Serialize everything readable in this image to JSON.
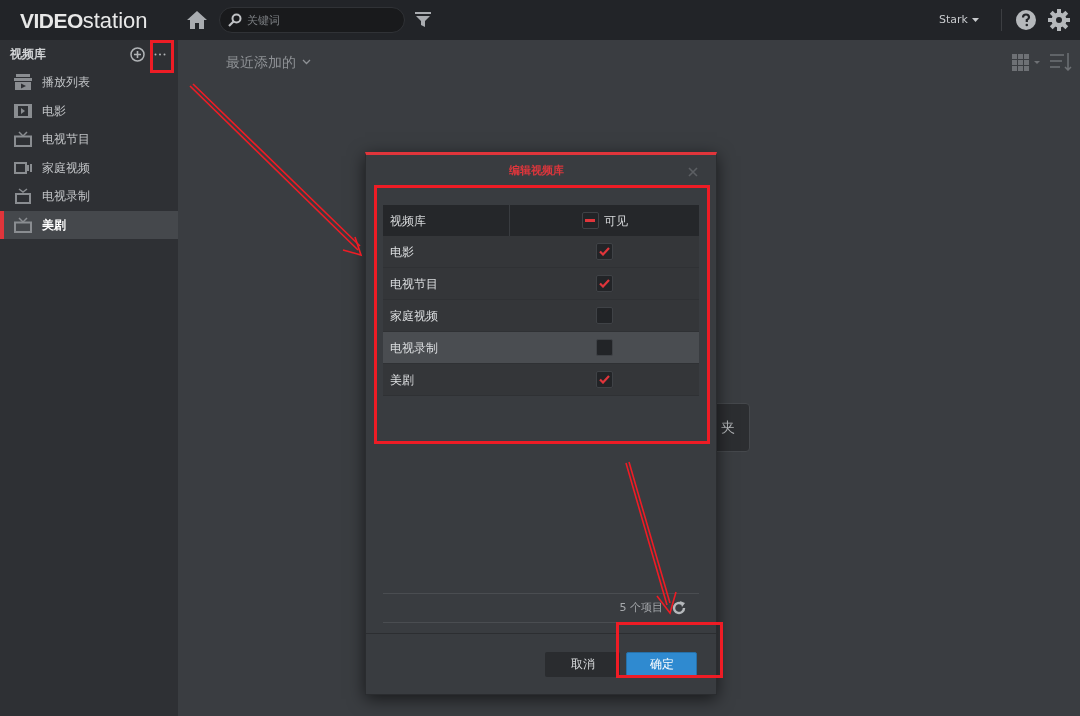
{
  "logo": {
    "brand": "VIDEO",
    "product": "station"
  },
  "search": {
    "placeholder": "关键词"
  },
  "user": {
    "name": "Stark"
  },
  "sidebar": {
    "title": "视频库",
    "items": [
      {
        "label": "播放列表",
        "kind": "playlist",
        "selected": false
      },
      {
        "label": "电影",
        "kind": "film",
        "selected": false
      },
      {
        "label": "电视节目",
        "kind": "tv",
        "selected": false
      },
      {
        "label": "家庭视频",
        "kind": "camera",
        "selected": false
      },
      {
        "label": "电视录制",
        "kind": "rec",
        "selected": false
      },
      {
        "label": "美剧",
        "kind": "tv",
        "selected": true
      }
    ]
  },
  "main": {
    "sort": "最近添加的",
    "popup_text": "夹"
  },
  "dialog": {
    "title": "编辑视频库",
    "columns": [
      "视频库",
      "可见"
    ],
    "header_indeterminate": true,
    "rows": [
      {
        "name": "电影",
        "checked": true,
        "selected": false
      },
      {
        "name": "电视节目",
        "checked": true,
        "selected": false
      },
      {
        "name": "家庭视频",
        "checked": false,
        "selected": false
      },
      {
        "name": "电视录制",
        "checked": false,
        "selected": true
      },
      {
        "name": "美剧",
        "checked": true,
        "selected": false
      }
    ],
    "count": "5 个项目",
    "buttons": {
      "cancel": "取消",
      "ok": "确定"
    }
  }
}
